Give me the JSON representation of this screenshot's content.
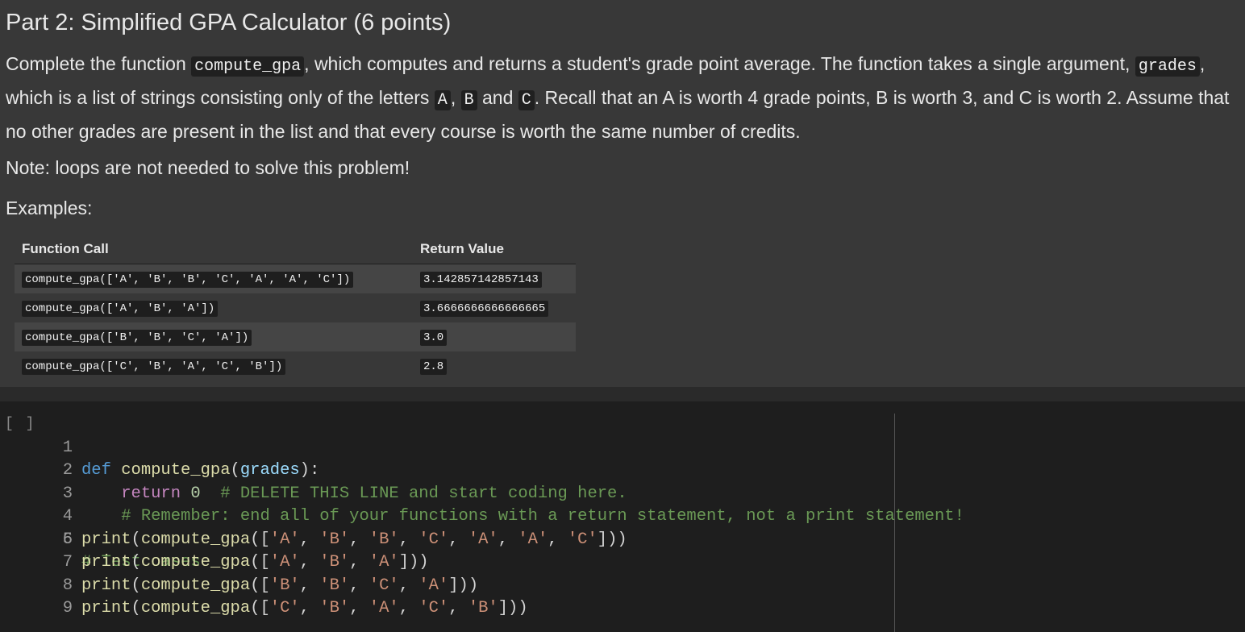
{
  "markdown": {
    "title": "Part 2: Simplified GPA Calculator (6 points)",
    "desc": {
      "t1": "Complete the function ",
      "c1": "compute_gpa",
      "t2": ", which computes and returns a student's grade point average. The function takes a single argument, ",
      "c2": "grades",
      "t3": ", which is a list of strings consisting only of the letters ",
      "c3": "A",
      "t4": ", ",
      "c4": "B",
      "t5": " and ",
      "c5": "C",
      "t6": ". Recall that an A is worth 4 grade points, B is worth 3, and C is worth 2. Assume that no other grades are present in the list and that every course is worth the same number of credits."
    },
    "note": "Note: loops are not needed to solve this problem!",
    "examples_label": "Examples:",
    "table": {
      "headers": [
        "Function Call",
        "Return Value"
      ],
      "rows": [
        {
          "call": "compute_gpa(['A', 'B', 'B', 'C', 'A', 'A', 'C'])",
          "value": "3.142857142857143"
        },
        {
          "call": "compute_gpa(['A', 'B', 'A'])",
          "value": "3.6666666666666665"
        },
        {
          "call": "compute_gpa(['B', 'B', 'C', 'A'])",
          "value": "3.0"
        },
        {
          "call": "compute_gpa(['C', 'B', 'A', 'C', 'B'])",
          "value": "2.8"
        }
      ]
    }
  },
  "code_cell": {
    "run_label": "[ ]",
    "line_numbers": [
      "1",
      "2",
      "3",
      "4",
      "5",
      "6",
      "7",
      "8",
      "9"
    ],
    "code": {
      "l1": {
        "kw": "def",
        "fn": "compute_gpa",
        "open": "(",
        "param": "grades",
        "close": "):"
      },
      "l2": {
        "kw": "return",
        "num": "0",
        "comment": "# DELETE THIS LINE and start coding here."
      },
      "l3": {
        "comment": "# Remember: end all of your functions with a return statement, not a print statement!"
      },
      "l5": {
        "comment": "# Test cases"
      },
      "print_fn": "print",
      "call_fn": "compute_gpa",
      "args": [
        [
          "'A'",
          "'B'",
          "'B'",
          "'C'",
          "'A'",
          "'A'",
          "'C'"
        ],
        [
          "'A'",
          "'B'",
          "'A'"
        ],
        [
          "'B'",
          "'B'",
          "'C'",
          "'A'"
        ],
        [
          "'C'",
          "'B'",
          "'A'",
          "'C'",
          "'B'"
        ]
      ]
    }
  }
}
